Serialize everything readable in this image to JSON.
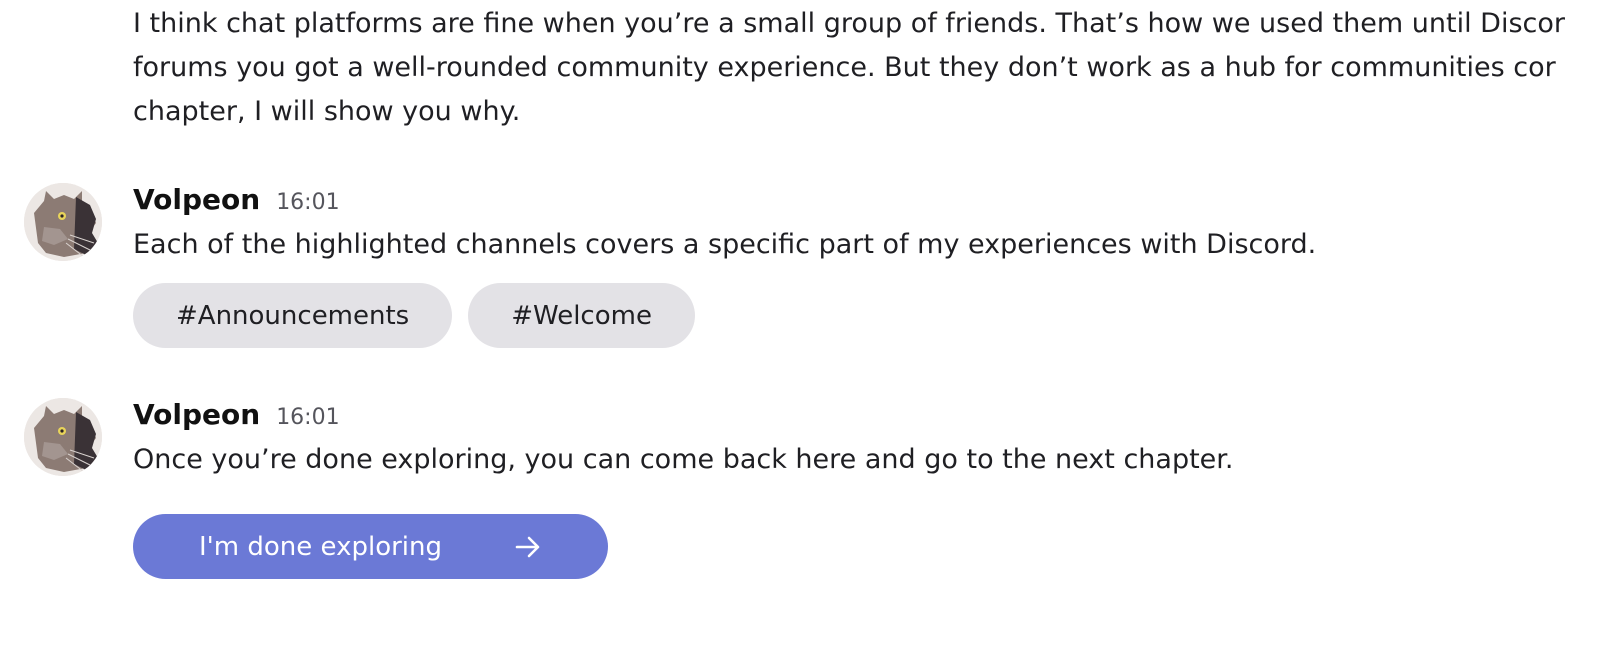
{
  "intro": {
    "lines": [
      "I think chat platforms are fine when you’re a small group of friends. That’s how we used them until Discor",
      "forums you got a well-rounded community experience. But they don’t work as a hub for communities cor",
      "chapter, I will show you why."
    ]
  },
  "messages": [
    {
      "author": "Volpeon",
      "time": "16:01",
      "text": "Each of the highlighted channels covers a specific part of my experiences with Discord.",
      "channels": [
        "#Announcements",
        "#Welcome"
      ]
    },
    {
      "author": "Volpeon",
      "time": "16:01",
      "text": "Once you’re done exploring, you can come back here and go to the next chapter.",
      "button_label": "I'm done exploring"
    }
  ],
  "icons": {
    "avatar": "dragon-avatar",
    "button_icon": "arrow-right-icon"
  },
  "colors": {
    "accent": "#6b79d6",
    "chip_background": "#e3e2e6",
    "text": "#1f1f23"
  }
}
